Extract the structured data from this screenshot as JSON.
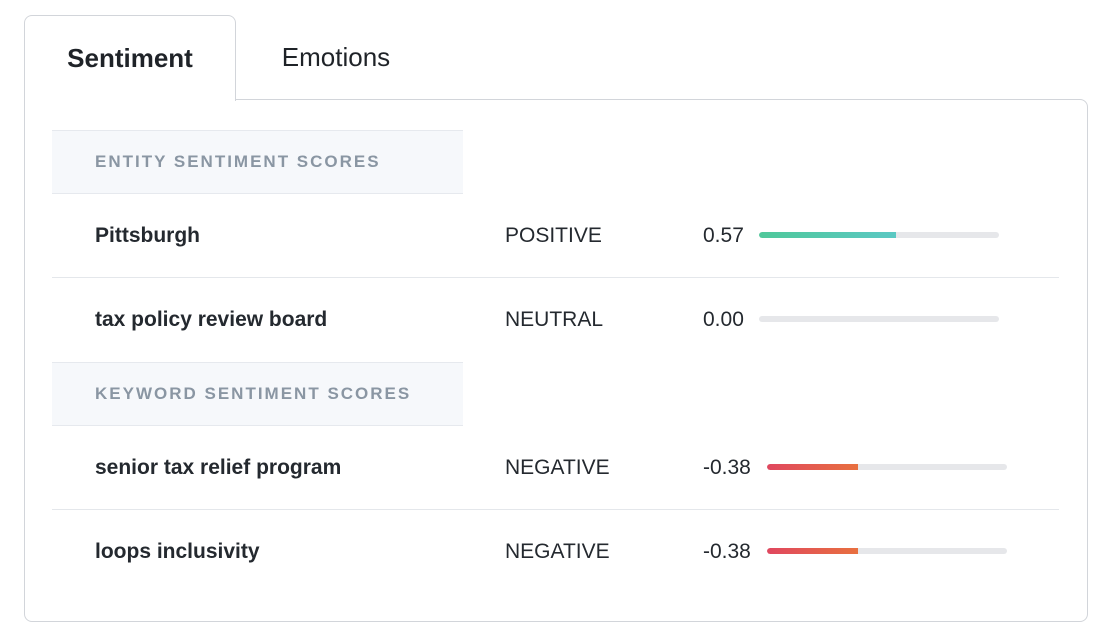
{
  "tabs": [
    {
      "label": "Sentiment",
      "active": true
    },
    {
      "label": "Emotions",
      "active": false
    }
  ],
  "sections": [
    {
      "header": "Entity Sentiment Scores",
      "rows": [
        {
          "name": "Pittsburgh",
          "label": "POSITIVE",
          "score": "0.57",
          "value": 0.57
        },
        {
          "name": "tax policy review board",
          "label": "NEUTRAL",
          "score": "0.00",
          "value": 0.0
        }
      ]
    },
    {
      "header": "Keyword Sentiment Scores",
      "rows": [
        {
          "name": "senior tax relief program",
          "label": "NEGATIVE",
          "score": "-0.38",
          "value": -0.38
        },
        {
          "name": "loops inclusivity",
          "label": "NEGATIVE",
          "score": "-0.38",
          "value": -0.38
        }
      ]
    }
  ],
  "colors": {
    "positive_start": "#4fc89a",
    "positive_end": "#5bc8c3",
    "negative_start": "#e0475f",
    "negative_end": "#e8703f",
    "track": "#e6e7ea",
    "section_header_text": "#8a96a3"
  }
}
